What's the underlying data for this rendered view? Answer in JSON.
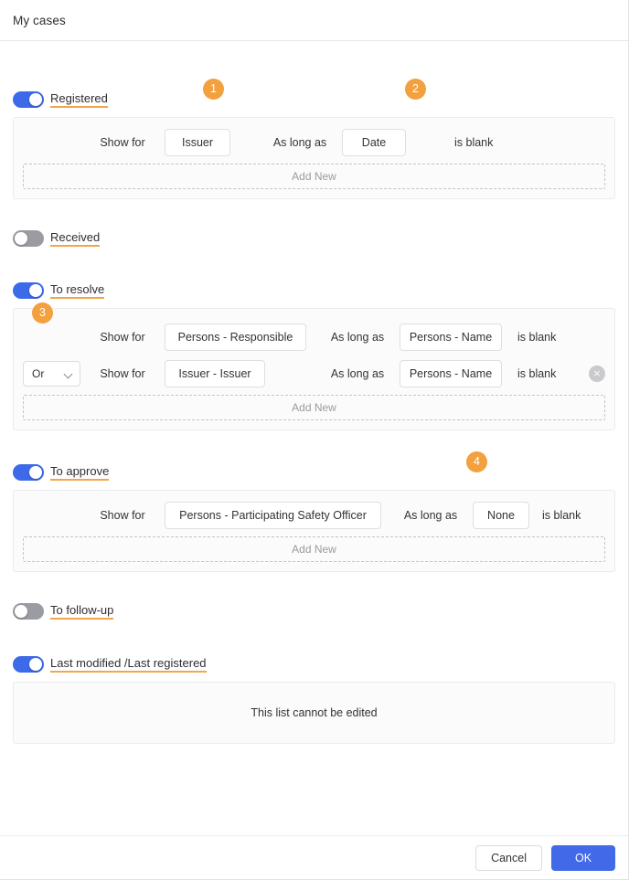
{
  "window": {
    "title": "My cases"
  },
  "labels": {
    "show_for": "Show for",
    "as_long_as": "As long as",
    "is_blank": "is blank",
    "add_new": "Add New",
    "delete_icon": "×"
  },
  "sections": [
    {
      "id": "registered",
      "label": "Registered",
      "toggle_state": "on",
      "editable": true,
      "rules": [
        {
          "conj": null,
          "field_left": "Issuer",
          "field_right": "Date"
        }
      ]
    },
    {
      "id": "received",
      "label": "Received",
      "toggle_state": "off",
      "editable": false,
      "rules": []
    },
    {
      "id": "to-resolve",
      "label": "To resolve",
      "toggle_state": "on",
      "editable": true,
      "rules": [
        {
          "conj": null,
          "field_left": "Persons - Responsible",
          "field_right": "Persons - Name"
        },
        {
          "conj": "Or",
          "field_left": "Issuer - Issuer",
          "field_right": "Persons - Name"
        }
      ]
    },
    {
      "id": "to-approve",
      "label": "To approve",
      "toggle_state": "on",
      "editable": true,
      "rules": [
        {
          "conj": null,
          "field_left": "Persons - Participating Safety Officer",
          "field_right": "None"
        }
      ]
    },
    {
      "id": "to-follow-up",
      "label": "To follow-up",
      "toggle_state": "off",
      "editable": false,
      "rules": []
    },
    {
      "id": "last-modified",
      "label": "Last modified /Last registered",
      "toggle_state": "on",
      "editable": false,
      "readonly_message": "This list cannot be edited",
      "rules": []
    }
  ],
  "badges": [
    {
      "number": "1",
      "target": "registered-field-left"
    },
    {
      "number": "2",
      "target": "registered-field-right"
    },
    {
      "number": "3",
      "target": "to-resolve-conjunction"
    },
    {
      "number": "4",
      "target": "to-approve-field-right"
    }
  ],
  "footer": {
    "cancel_label": "Cancel",
    "ok_label": "OK"
  },
  "colors": {
    "toggle_on": "#3d6ae8",
    "toggle_off": "#9b9ba2",
    "badge": "#f3a03f",
    "underline": "#f0a64a",
    "primary_button": "#4169e8"
  }
}
